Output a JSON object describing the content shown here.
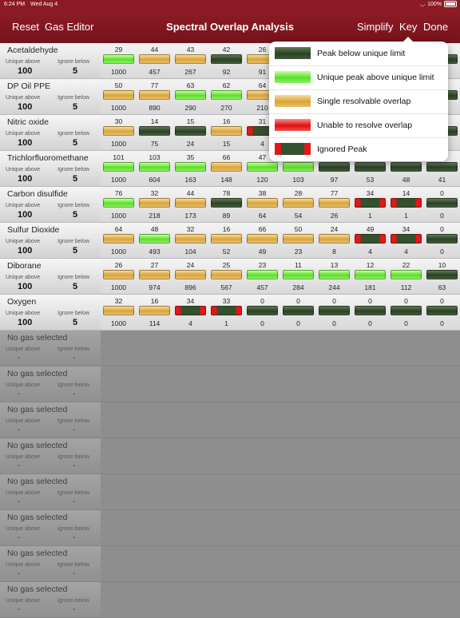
{
  "status_bar": {
    "time": "6:24 PM",
    "date": "Wed Aug 4",
    "battery": "100%"
  },
  "nav": {
    "reset": "Reset",
    "gas_editor": "Gas Editor",
    "title": "Spectral Overlap Analysis",
    "simplify": "Simplify",
    "key": "Key",
    "done": "Done"
  },
  "labels": {
    "unique_above": "Unique above",
    "ignore_below": "Ignore below"
  },
  "colors": {
    "dark": "#2b4225",
    "green": "#58e02a",
    "orange": "#d9a43a",
    "red": "#dd1010"
  },
  "rows": [
    {
      "name": "Acetaldehyde",
      "unique_above": "100",
      "ignore_below": "5",
      "top": [
        "29",
        "44",
        "43",
        "42",
        "26",
        "",
        "",
        "",
        "",
        ""
      ],
      "bottom": [
        "1000",
        "457",
        "267",
        "92",
        "91",
        "",
        "",
        "",
        "",
        ""
      ],
      "colors": [
        "green",
        "orange",
        "orange",
        "dark",
        "orange",
        "dark",
        "dark",
        "dark",
        "dark",
        "dark"
      ]
    },
    {
      "name": "DP Oil PPE",
      "unique_above": "100",
      "ignore_below": "5",
      "top": [
        "50",
        "77",
        "63",
        "62",
        "64",
        "",
        "",
        "",
        "",
        ""
      ],
      "bottom": [
        "1000",
        "890",
        "290",
        "270",
        "210",
        "",
        "",
        "",
        "",
        ""
      ],
      "colors": [
        "orange",
        "orange",
        "green",
        "green",
        "orange",
        "dark",
        "dark",
        "dark",
        "dark",
        "dark"
      ]
    },
    {
      "name": "Nitric oxide",
      "unique_above": "100",
      "ignore_below": "5",
      "top": [
        "30",
        "14",
        "15",
        "16",
        "31",
        "",
        "",
        "",
        "",
        ""
      ],
      "bottom": [
        "1000",
        "75",
        "24",
        "15",
        "4",
        "",
        "",
        "",
        "",
        ""
      ],
      "colors": [
        "orange",
        "dark",
        "dark",
        "orange",
        "ign",
        "dark",
        "dark",
        "dark",
        "dark",
        "dark"
      ]
    },
    {
      "name": "Trichlorfluoromethane",
      "unique_above": "100",
      "ignore_below": "5",
      "top": [
        "101",
        "103",
        "35",
        "66",
        "47",
        "",
        "",
        "",
        "",
        ""
      ],
      "bottom": [
        "1000",
        "604",
        "163",
        "148",
        "120",
        "103",
        "97",
        "53",
        "48",
        "41"
      ],
      "colors": [
        "green",
        "green",
        "green",
        "orange",
        "green",
        "green",
        "dark",
        "dark",
        "dark",
        "dark"
      ]
    },
    {
      "name": "Carbon disulfide",
      "unique_above": "100",
      "ignore_below": "5",
      "top": [
        "76",
        "32",
        "44",
        "78",
        "38",
        "28",
        "77",
        "34",
        "14",
        "0"
      ],
      "bottom": [
        "1000",
        "218",
        "173",
        "89",
        "64",
        "54",
        "26",
        "1",
        "1",
        "0"
      ],
      "colors": [
        "green",
        "orange",
        "orange",
        "dark",
        "orange",
        "orange",
        "orange",
        "ign",
        "ign",
        "dark"
      ]
    },
    {
      "name": "Sulfur Dioxide",
      "unique_above": "100",
      "ignore_below": "5",
      "top": [
        "64",
        "48",
        "32",
        "16",
        "66",
        "50",
        "24",
        "49",
        "34",
        "0"
      ],
      "bottom": [
        "1000",
        "493",
        "104",
        "52",
        "49",
        "23",
        "8",
        "4",
        "4",
        "0"
      ],
      "colors": [
        "orange",
        "green",
        "orange",
        "orange",
        "orange",
        "orange",
        "orange",
        "ign",
        "ign",
        "dark"
      ]
    },
    {
      "name": "Diborane",
      "unique_above": "100",
      "ignore_below": "5",
      "top": [
        "26",
        "27",
        "24",
        "25",
        "23",
        "11",
        "13",
        "12",
        "22",
        "10"
      ],
      "bottom": [
        "1000",
        "974",
        "896",
        "567",
        "457",
        "284",
        "244",
        "181",
        "112",
        "63"
      ],
      "colors": [
        "orange",
        "orange",
        "orange",
        "orange",
        "green",
        "green",
        "green",
        "green",
        "green",
        "dark"
      ]
    },
    {
      "name": "Oxygen",
      "unique_above": "100",
      "ignore_below": "5",
      "top": [
        "32",
        "16",
        "34",
        "33",
        "0",
        "0",
        "0",
        "0",
        "0",
        "0"
      ],
      "bottom": [
        "1000",
        "114",
        "4",
        "1",
        "0",
        "0",
        "0",
        "0",
        "0",
        "0"
      ],
      "colors": [
        "orange",
        "orange",
        "ign",
        "ign",
        "dark",
        "dark",
        "dark",
        "dark",
        "dark",
        "dark"
      ]
    }
  ],
  "empty_rows": [
    {
      "name": "No gas selected",
      "unique_above": "-",
      "ignore_below": "-"
    },
    {
      "name": "No gas selected",
      "unique_above": "-",
      "ignore_below": "-"
    },
    {
      "name": "No gas selected",
      "unique_above": "-",
      "ignore_below": "-"
    },
    {
      "name": "No gas selected",
      "unique_above": "-",
      "ignore_below": "-"
    },
    {
      "name": "No gas selected",
      "unique_above": "-",
      "ignore_below": "-"
    },
    {
      "name": "No gas selected",
      "unique_above": "-",
      "ignore_below": "-"
    },
    {
      "name": "No gas selected",
      "unique_above": "-",
      "ignore_below": "-"
    },
    {
      "name": "No gas selected",
      "unique_above": "-",
      "ignore_below": "-"
    }
  ],
  "key_popover": {
    "items": [
      {
        "swatch": "dark",
        "label": "Peak below unique limit"
      },
      {
        "swatch": "green",
        "label": "Unique peak above unique limit"
      },
      {
        "swatch": "orange",
        "label": "Single resolvable overlap"
      },
      {
        "swatch": "red",
        "label": "Unable to resolve overlap"
      },
      {
        "swatch": "ign",
        "label": "Ignored Peak"
      }
    ]
  }
}
